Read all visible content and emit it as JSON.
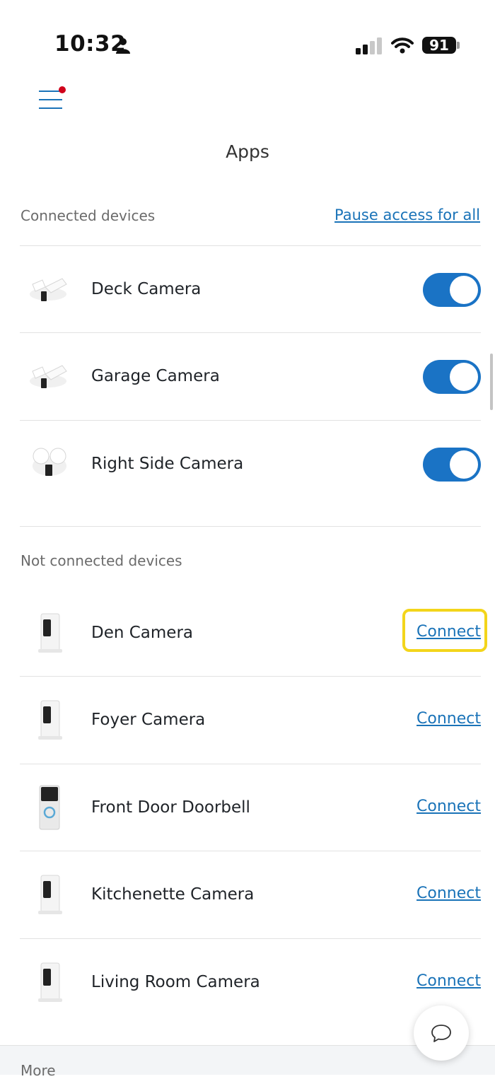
{
  "status_bar": {
    "time": "10:32",
    "battery": "91"
  },
  "header": {
    "title": "Apps"
  },
  "connected": {
    "label": "Connected devices",
    "pause_all": "Pause access for all",
    "devices": [
      {
        "name": "Deck Camera",
        "icon": "floodlight-camera-icon",
        "enabled": true
      },
      {
        "name": "Garage Camera",
        "icon": "floodlight-camera-icon",
        "enabled": true
      },
      {
        "name": "Right Side Camera",
        "icon": "floodlight-camera-icon",
        "enabled": true
      }
    ]
  },
  "not_connected": {
    "label": "Not connected devices",
    "connect_label": "Connect",
    "devices": [
      {
        "name": "Den Camera",
        "icon": "stick-up-camera-icon"
      },
      {
        "name": "Foyer Camera",
        "icon": "stick-up-camera-icon"
      },
      {
        "name": "Front Door Doorbell",
        "icon": "video-doorbell-icon"
      },
      {
        "name": "Kitchenette Camera",
        "icon": "stick-up-camera-icon"
      },
      {
        "name": "Living Room Camera",
        "icon": "stick-up-camera-icon"
      }
    ]
  },
  "more": {
    "label": "More"
  },
  "colors": {
    "accent": "#1a73c5",
    "link": "#1a73b8",
    "highlight": "#f3d51b",
    "notification": "#d0021b"
  }
}
